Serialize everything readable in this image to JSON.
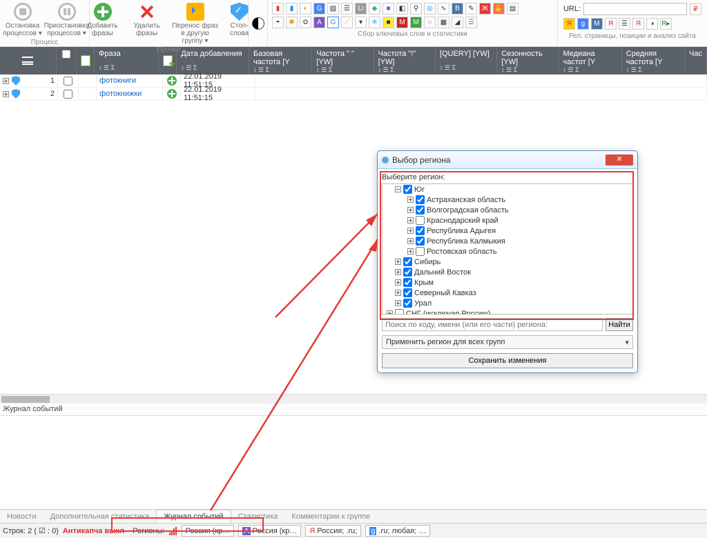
{
  "ribbon": {
    "process": {
      "label": "Процесс",
      "stop": "Остановка процессов ▾",
      "pause": "Приостановка процессов ▾"
    },
    "other": {
      "label": "Прочее",
      "add": "Добавить фразы",
      "del": "Удалить фразы",
      "move": "Перенос фраз в другую группу ▾",
      "stopw": "Стоп-слова"
    },
    "collect_label": "Сбор ключевых слов и статистики",
    "url_label": "URL:",
    "analysis_label": "Рел. страницы, позиции и анализ сайта"
  },
  "columns": {
    "phrase": "Фраза",
    "date": "Дата добавления",
    "base": "Базовая частота [Y",
    "freq2": "Частота \" \" [YW]",
    "freq3": "Частота \"!\" [YW]",
    "query": "[QUERY] [YW]",
    "season": "Сезонность [YW]",
    "median": "Медиана частот [Y",
    "avg": "Средняя частота [Y",
    "last": "Час"
  },
  "rows": [
    {
      "num": "1",
      "phrase": "фотокниги",
      "date": "22.01.2019 11:51:15"
    },
    {
      "num": "2",
      "phrase": "фотокнижки",
      "date": "22.01.2019 11:51:15"
    }
  ],
  "log_title": "Журнал событий",
  "tabs": {
    "lbls": [
      "Новости",
      "Дополнительная статистика",
      "Журнал событий",
      "Статистика",
      "Комментарии к группе"
    ]
  },
  "status": {
    "rows": "Строк: 2 ( ☑ : 0)",
    "anticaptcha": "Антикапча выкл",
    "regions_lbl": "Регионы:",
    "r1": "Россия (кр…",
    "r2": "Россия (кр…",
    "r3": "Россия; .ru;",
    "r4": ".ru; любая; …"
  },
  "dialog": {
    "title": "Выбор региона",
    "prompt": "Выберите регион:",
    "tree": {
      "yug": "Юг",
      "astr": "Астраханская область",
      "volg": "Волгоградская область",
      "kras": "Краснодарский край",
      "adyg": "Республика Адыгея",
      "kalm": "Республика Калмыкия",
      "rost": "Ростовская область",
      "sib": "Сибирь",
      "dal": "Дальний Восток",
      "krym": "Крым",
      "sev": "Северный Кавказ",
      "ural": "Урал",
      "sng": "СНГ (исключая Россию)"
    },
    "search_ph": "Поиск по коду, имени (или его части) региона:",
    "search_btn": "Найти",
    "apply_all": "Применить регион для всех групп",
    "save": "Сохранить изменения"
  }
}
